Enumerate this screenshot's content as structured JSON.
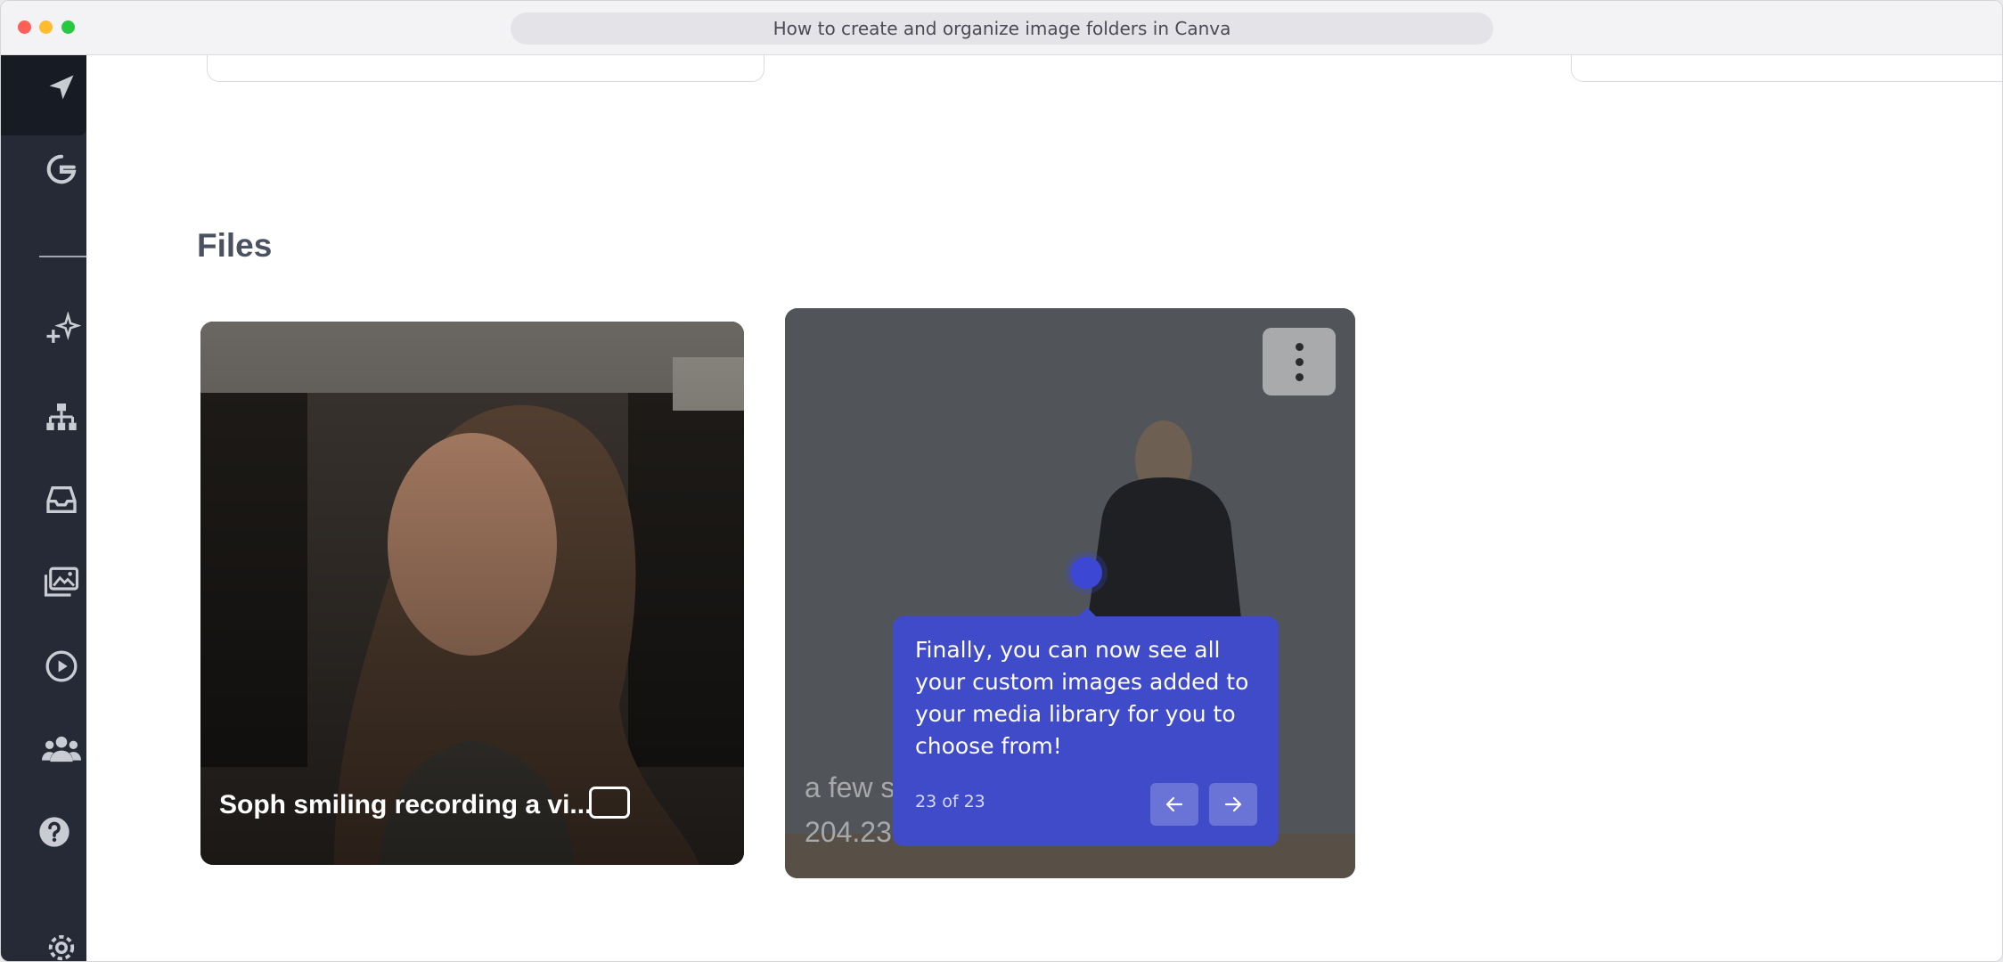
{
  "window": {
    "title": "How to create and organize image folders in Canva"
  },
  "sidebar": {
    "items": [
      {
        "icon": "navigation-arrow-icon"
      },
      {
        "icon": "google-g-icon"
      },
      {
        "icon": "sparkle-plus-icon"
      },
      {
        "icon": "sitemap-icon"
      },
      {
        "icon": "inbox-icon"
      },
      {
        "icon": "image-gallery-icon"
      },
      {
        "icon": "play-circle-icon"
      },
      {
        "icon": "users-icon"
      },
      {
        "icon": "help-circle-icon"
      },
      {
        "icon": "gear-icon"
      }
    ]
  },
  "main": {
    "files_heading": "Files",
    "cards": [
      {
        "title": "Soph smiling recording a vi..."
      },
      {
        "truncated_label": "...",
        "time": "a few seconds ago",
        "size": "204.23 KB"
      }
    ]
  },
  "tooltip": {
    "body": "Finally, you can now see all your custom images added to your media library for you to choose from!",
    "counter": "23 of 23"
  },
  "colors": {
    "sidebar_bg": "#252a36",
    "tooltip_bg": "#3f4bc8",
    "hotspot": "#3c48d4"
  }
}
